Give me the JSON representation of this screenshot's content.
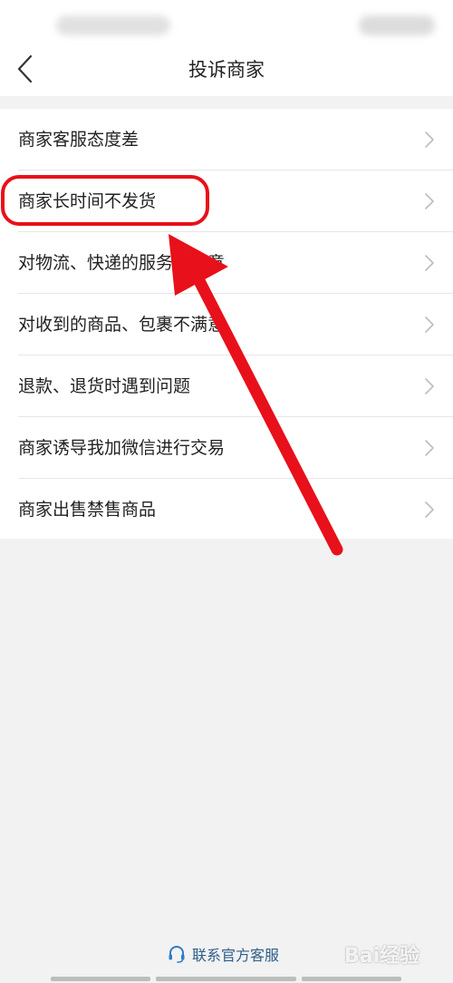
{
  "header": {
    "title": "投诉商家",
    "back_icon": "chevron-left-icon"
  },
  "complaint_options": [
    {
      "label": "商家客服态度差",
      "icon": "chevron-right-icon"
    },
    {
      "label": "商家长时间不发货",
      "icon": "chevron-right-icon",
      "highlighted": true
    },
    {
      "label": "对物流、快递的服务不满意",
      "icon": "chevron-right-icon"
    },
    {
      "label": "对收到的商品、包裹不满意",
      "icon": "chevron-right-icon"
    },
    {
      "label": "退款、退货时遇到问题",
      "icon": "chevron-right-icon"
    },
    {
      "label": "商家诱导我加微信进行交易",
      "icon": "chevron-right-icon"
    },
    {
      "label": "商家出售禁售商品",
      "icon": "chevron-right-icon"
    }
  ],
  "footer": {
    "contact_label": "联系官方客服",
    "contact_icon": "headset-icon"
  },
  "watermark": {
    "text": "Bai经验"
  },
  "colors": {
    "background": "#f2f2f2",
    "card": "#ffffff",
    "annotation": "#e8101a",
    "link": "#2e5f8a"
  }
}
